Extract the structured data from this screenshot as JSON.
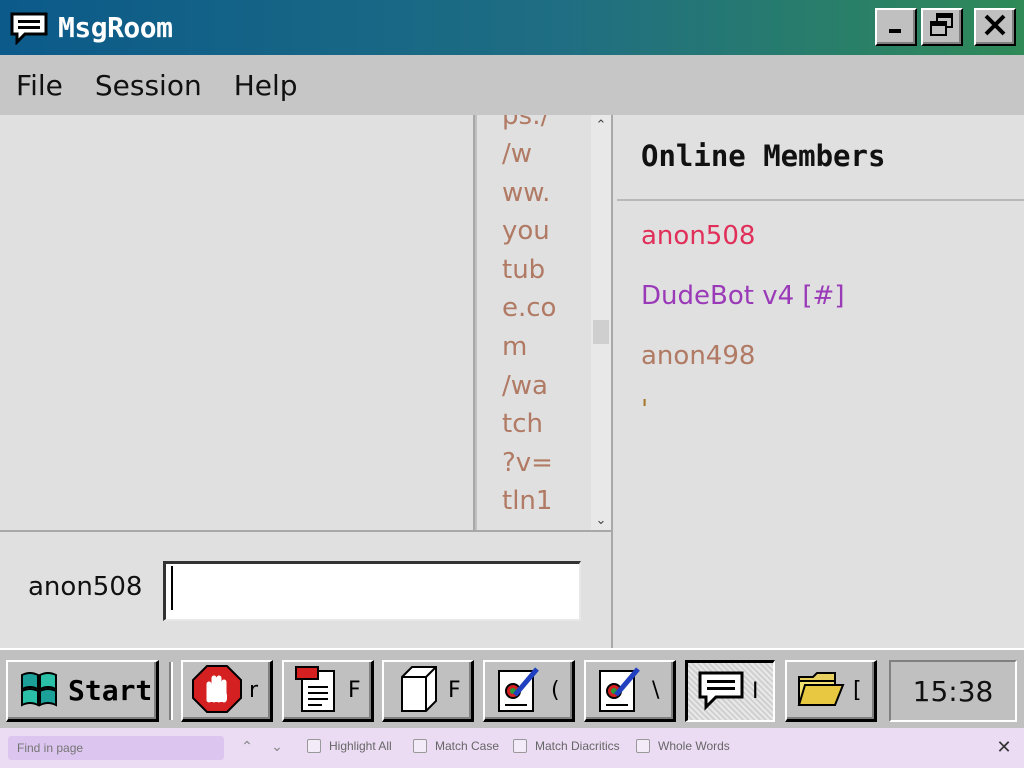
{
  "window": {
    "title": "MsgRoom",
    "icon": "speech-bubble-icon",
    "controls": [
      "minimize-icon",
      "restore-icon",
      "close-icon"
    ]
  },
  "menu": {
    "items": [
      "File",
      "Session",
      "Help"
    ]
  },
  "chat": {
    "url_fragments": [
      "ps:/",
      "/w",
      "ww.",
      "you",
      "tub",
      "e.co",
      "m",
      "/wa",
      "tch",
      "?v=",
      "tln1"
    ],
    "url_color": "#b07a64"
  },
  "members": {
    "title": "Online Members",
    "list": [
      {
        "name": "anon508",
        "color": "#e0305a"
      },
      {
        "name": "DudeBot v4 [#]",
        "color": "#9a3ab8"
      },
      {
        "name": "anon498",
        "color": "#b07a64"
      },
      {
        "name": "'",
        "color": "#a87a30"
      }
    ]
  },
  "composer": {
    "nickname": "anon508",
    "message_value": ""
  },
  "taskbar": {
    "start_label": "Start",
    "buttons": [
      {
        "icon": "stop-hand-icon",
        "label": "r"
      },
      {
        "icon": "document-icon",
        "label": "F"
      },
      {
        "icon": "blank-box-icon",
        "label": "F"
      },
      {
        "icon": "checklist-icon",
        "label": "("
      },
      {
        "icon": "checklist-icon",
        "label": "\\"
      },
      {
        "icon": "speech-bubble-icon",
        "label": "I"
      },
      {
        "icon": "folder-icon",
        "label": "["
      }
    ],
    "clock": "15:38"
  },
  "findbar": {
    "placeholder": "Find in page",
    "options": [
      "Highlight All",
      "Match Case",
      "Match Diacritics",
      "Whole Words"
    ]
  }
}
